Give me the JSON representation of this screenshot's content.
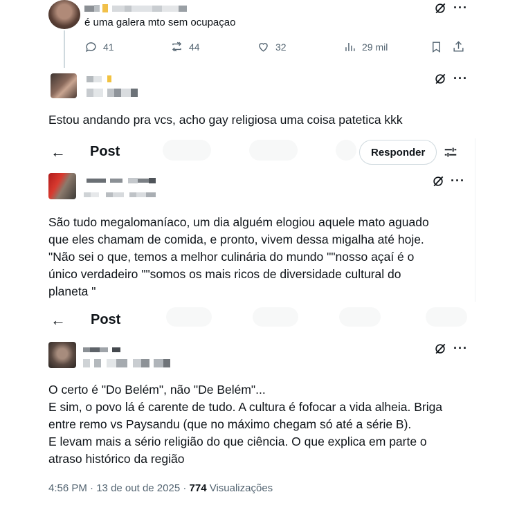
{
  "reply_top": {
    "text": "é uma galera mto sem ocupaçao",
    "stats": {
      "replies": "41",
      "reposts": "44",
      "likes": "32",
      "views": "29 mil"
    }
  },
  "reply_second": {
    "text": "Estou andando pra vcs, acho gay religiosa uma coisa patetica kkk"
  },
  "header_one": {
    "title": "Post",
    "respond_label": "Responder"
  },
  "post_middle": {
    "lines": [
      "São tudo megalomaníaco, um dia alguém elogiou aquele mato aguado",
      "que eles chamam de comida, e pronto, vivem dessa migalha até hoje.",
      "\"Não sei o que, temos a melhor culinária do mundo \"\"nosso açaí é o",
      "único verdadeiro \"\"somos os mais ricos de diversidade cultural do",
      "planeta \""
    ]
  },
  "header_two": {
    "title": "Post"
  },
  "post_bottom": {
    "lines": [
      "O certo é \"Do Belém\", não \"De Belém\"...",
      "E sim, o povo lá é carente de tudo. A cultura é fofocar a vida alheia. Briga",
      "entre remo vs Paysandu (que no máximo chegam só até a série B).",
      "E levam mais a sério religião do que ciência. O que explica em parte o",
      "atraso histórico da região"
    ],
    "time": "4:56 PM",
    "date": "13 de out de 2025",
    "views_count": "774",
    "views_label": "Visualizações"
  },
  "icons": {
    "reply": "reply-icon",
    "repost": "repost-icon",
    "like": "heart-icon",
    "views": "views-icon",
    "bookmark": "bookmark-icon",
    "share": "share-icon",
    "grok": "grok-icon",
    "more": "more-icon",
    "back": "back-arrow-icon",
    "filter": "filter-icon"
  }
}
